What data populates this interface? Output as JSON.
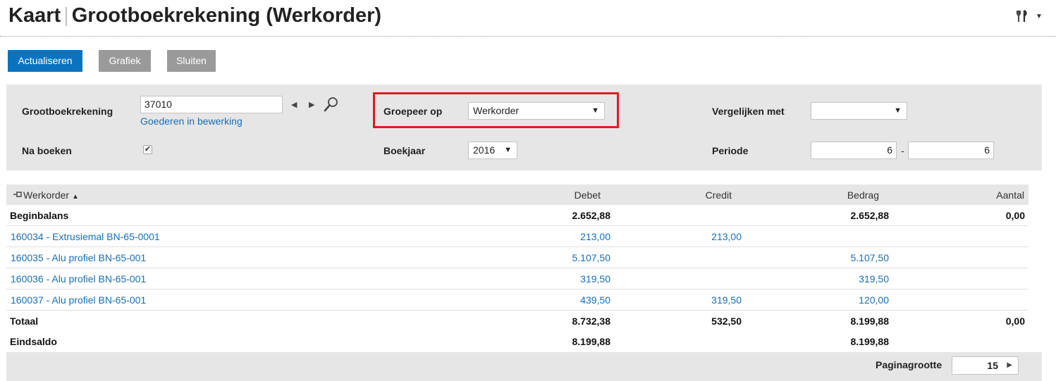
{
  "header": {
    "title_part1": "Kaart",
    "title_part2": "Grootboekrekening (Werkorder)",
    "tools_icon": "tools-icon"
  },
  "toolbar": {
    "refresh_label": "Actualiseren",
    "chart_label": "Grafiek",
    "close_label": "Sluiten"
  },
  "filters": {
    "account_label": "Grootboekrekening",
    "account_value": "37010",
    "account_description": "Goederen in bewerking",
    "post_label": "Na boeken",
    "post_checked": true,
    "group_label": "Groepeer op",
    "group_value": "Werkorder",
    "year_label": "Boekjaar",
    "year_value": "2016",
    "compare_label": "Vergelijken met",
    "compare_value": "",
    "period_label": "Periode",
    "period_from": "6",
    "period_separator": "-",
    "period_to": "6"
  },
  "table": {
    "columns": {
      "workorder": "Werkorder",
      "debit": "Debet",
      "credit": "Credit",
      "amount": "Bedrag",
      "quantity": "Aantal"
    },
    "rows": [
      {
        "label": "Beginbalans",
        "debit": "2.652,88",
        "credit": "",
        "amount": "2.652,88",
        "quantity": "0,00"
      },
      {
        "label": "160034 - Extrusiemal BN-65-0001",
        "debit": "213,00",
        "credit": "213,00",
        "amount": "",
        "quantity": ""
      },
      {
        "label": "160035 - Alu profiel BN-65-001",
        "debit": "5.107,50",
        "credit": "",
        "amount": "5.107,50",
        "quantity": ""
      },
      {
        "label": "160036 - Alu profiel BN-65-001",
        "debit": "319,50",
        "credit": "",
        "amount": "319,50",
        "quantity": ""
      },
      {
        "label": "160037 - Alu profiel BN-65-001",
        "debit": "439,50",
        "credit": "319,50",
        "amount": "120,00",
        "quantity": ""
      },
      {
        "label": "Totaal",
        "debit": "8.732,38",
        "credit": "532,50",
        "amount": "8.199,88",
        "quantity": "0,00"
      },
      {
        "label": "Eindsaldo",
        "debit": "8.199,88",
        "credit": "",
        "amount": "8.199,88",
        "quantity": ""
      }
    ]
  },
  "footer": {
    "page_size_label": "Paginagrootte",
    "page_size_value": "15"
  },
  "colors": {
    "primary": "#0a73c0",
    "secondary": "#9a9a9a",
    "link": "#1a6eb5",
    "highlight": "#e11b22",
    "panel": "#e6e6e6"
  }
}
